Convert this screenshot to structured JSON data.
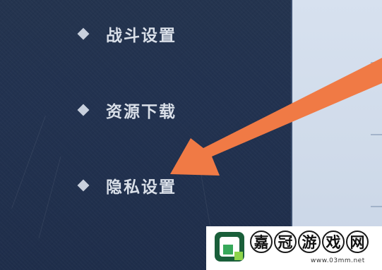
{
  "menu": {
    "items": [
      {
        "label": "战斗设置"
      },
      {
        "label": "资源下载"
      },
      {
        "label": "隐私设置"
      }
    ]
  },
  "annotation": {
    "arrow_color": "#f07a45",
    "points_to": "隐私设置"
  },
  "watermark": {
    "chars": [
      "嘉",
      "冠",
      "游",
      "戏",
      "网"
    ],
    "url": "www.03mm.net",
    "logo_colors": [
      "#1a5f3a",
      "#37a85a",
      "#8dd44a"
    ]
  },
  "colors": {
    "sidebar_bg": "#223250",
    "content_bg": "#d3deec",
    "text": "#d9dfe8"
  }
}
